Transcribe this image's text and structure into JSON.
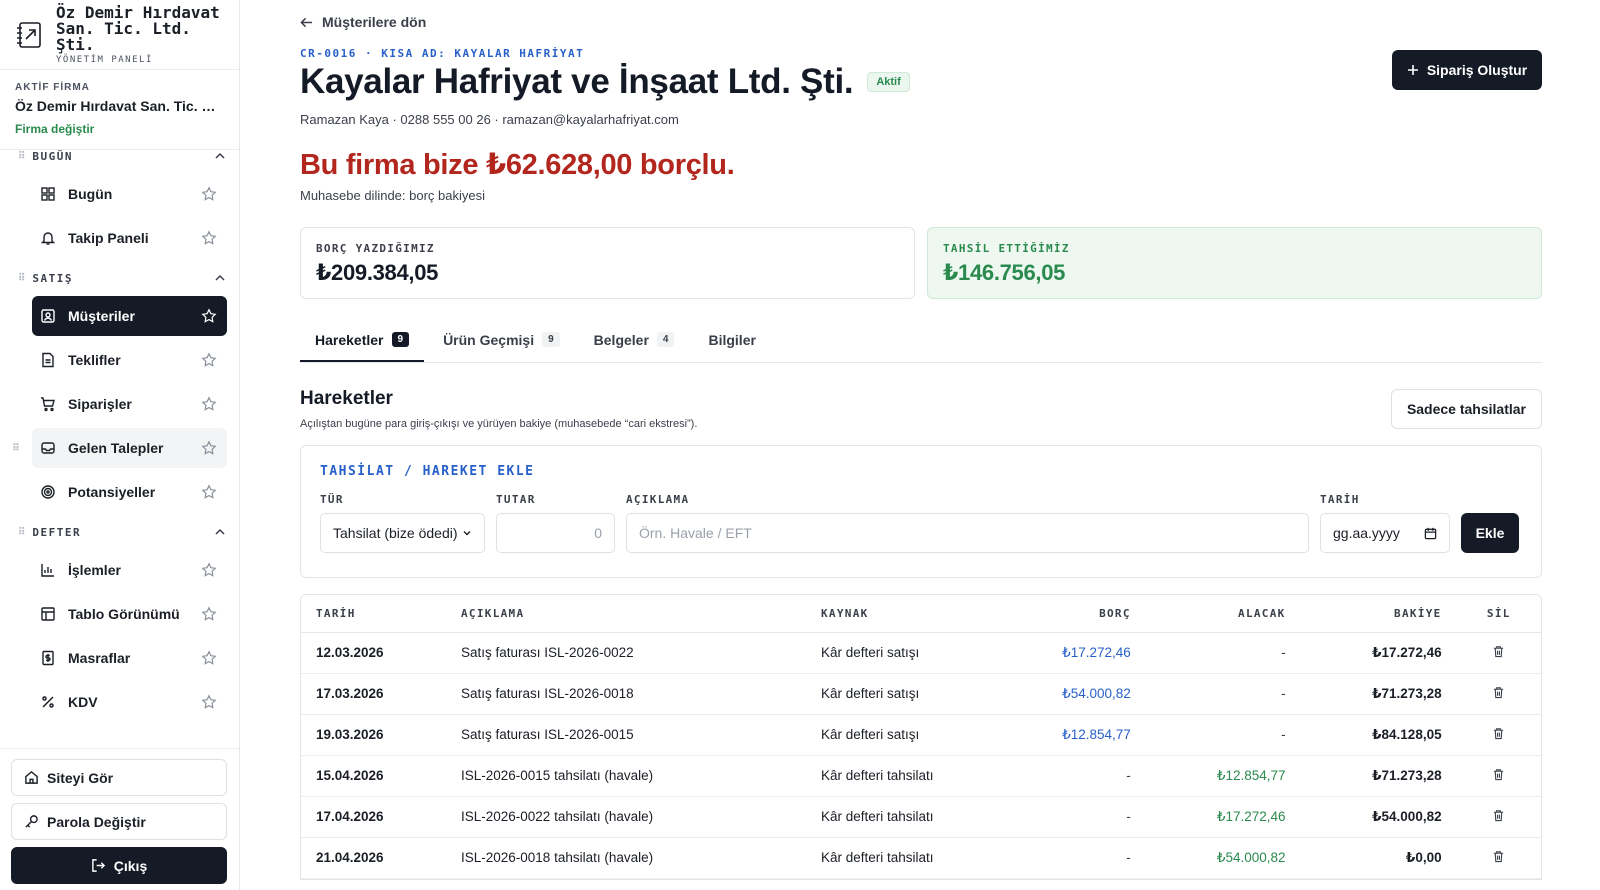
{
  "brand": {
    "name_line1": "Öz Demir Hırdavat",
    "name_line2": "San. Tic. Ltd. Şti.",
    "subtitle": "YÖNETİM PANELİ",
    "logo_icon": "ledger-arrow-icon"
  },
  "company": {
    "label": "AKTİF FİRMA",
    "name": "Öz Demir Hırdavat San. Tic. Ltd. Şti.",
    "change_link": "Firma değiştir"
  },
  "sidebar": {
    "sections": [
      {
        "title": "BUGÜN",
        "items": [
          {
            "label": "Bugün",
            "icon": "grid-icon"
          },
          {
            "label": "Takip Paneli",
            "icon": "bell-icon"
          }
        ]
      },
      {
        "title": "SATIŞ",
        "items": [
          {
            "label": "Müşteriler",
            "icon": "contact-icon",
            "active": true
          },
          {
            "label": "Teklifler",
            "icon": "document-icon"
          },
          {
            "label": "Siparişler",
            "icon": "cart-icon"
          },
          {
            "label": "Gelen Talepler",
            "icon": "inbox-icon"
          },
          {
            "label": "Potansiyeller",
            "icon": "target-icon"
          }
        ]
      },
      {
        "title": "DEFTER",
        "items": [
          {
            "label": "İşlemler",
            "icon": "bar-chart-icon"
          },
          {
            "label": "Tablo Görünümü",
            "icon": "table-icon"
          },
          {
            "label": "Masraflar",
            "icon": "receipt-icon"
          },
          {
            "label": "KDV",
            "icon": "percent-icon"
          }
        ]
      }
    ],
    "bottom": {
      "view_site": "Siteyi Gör",
      "change_password": "Parola Değiştir",
      "logout": "Çıkış"
    }
  },
  "header": {
    "back_label": "Müşterilere dön",
    "code_line": "CR-0016 · KISA AD: KAYALAR HAFRİYAT",
    "title": "Kayalar Hafriyat ve İnşaat Ltd. Şti.",
    "status_badge": "Aktif",
    "new_order_button": "Sipariş Oluştur",
    "contact_line": "Ramazan Kaya · 0288 555 00 26 · ramazan@kayalarhafriyat.com"
  },
  "summary": {
    "headline": "Bu firma bize ₺62.628,00 borçlu.",
    "subline": "Muhasebe dilinde: borç bakiyesi",
    "debit_label": "BORÇ YAZDIĞIMIZ",
    "debit_value": "₺209.384,05",
    "credit_label": "TAHSİL ETTİĞİMİZ",
    "credit_value": "₺146.756,05"
  },
  "tabs": [
    {
      "label": "Hareketler",
      "count": "9",
      "active": true
    },
    {
      "label": "Ürün Geçmişi",
      "count": "9"
    },
    {
      "label": "Belgeler",
      "count": "4"
    },
    {
      "label": "Bilgiler",
      "count": ""
    }
  ],
  "movements": {
    "title": "Hareketler",
    "description": "Açılıştan bugüne para giriş-çıkışı ve yürüyen bakiye (muhasebede “cari ekstresi”).",
    "filter_button": "Sadece tahsilatlar"
  },
  "form": {
    "title": "TAHSİLAT / HAREKET EKLE",
    "type_label": "TÜR",
    "type_value": "Tahsilat (bize ödedi)",
    "amount_label": "TUTAR",
    "amount_placeholder": "0",
    "desc_label": "AÇIKLAMA",
    "desc_placeholder": "Örn. Havale / EFT",
    "date_label": "TARİH",
    "date_placeholder": "gg.aa.yyyy",
    "submit": "Ekle"
  },
  "table": {
    "headers": [
      "TARİH",
      "AÇIKLAMA",
      "KAYNAK",
      "BORÇ",
      "ALACAK",
      "BAKİYE",
      "SİL"
    ],
    "rows": [
      {
        "date": "12.03.2026",
        "desc": "Satış faturası ISL-2026-0022",
        "source": "Kâr defteri satışı",
        "debit": "₺17.272,46",
        "credit": "-",
        "balance": "₺17.272,46"
      },
      {
        "date": "17.03.2026",
        "desc": "Satış faturası ISL-2026-0018",
        "source": "Kâr defteri satışı",
        "debit": "₺54.000,82",
        "credit": "-",
        "balance": "₺71.273,28"
      },
      {
        "date": "19.03.2026",
        "desc": "Satış faturası ISL-2026-0015",
        "source": "Kâr defteri satışı",
        "debit": "₺12.854,77",
        "credit": "-",
        "balance": "₺84.128,05"
      },
      {
        "date": "15.04.2026",
        "desc": "ISL-2026-0015 tahsilatı (havale)",
        "source": "Kâr defteri tahsilatı",
        "debit": "-",
        "credit": "₺12.854,77",
        "balance": "₺71.273,28"
      },
      {
        "date": "17.04.2026",
        "desc": "ISL-2026-0022 tahsilatı (havale)",
        "source": "Kâr defteri tahsilatı",
        "debit": "-",
        "credit": "₺17.272,46",
        "balance": "₺54.000,82"
      },
      {
        "date": "21.04.2026",
        "desc": "ISL-2026-0018 tahsilatı (havale)",
        "source": "Kâr defteri tahsilatı",
        "debit": "-",
        "credit": "₺54.000,82",
        "balance": "₺0,00"
      }
    ]
  },
  "colors": {
    "primary_dark": "#141b26",
    "accent_blue": "#2860c9",
    "success_green": "#2a8a4e",
    "danger_red": "#b3261e"
  }
}
